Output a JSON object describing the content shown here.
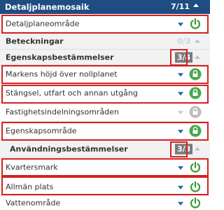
{
  "header": {
    "title": "Detaljplanemosaik",
    "count": "7/11"
  },
  "rows": {
    "detaljplaneomrade": {
      "label": "Detaljplaneområde"
    },
    "beteckningar": {
      "label": "Beteckningar",
      "count": "0/3"
    },
    "egenskapsbestammelser": {
      "label": "Egenskapsbestämmelser",
      "count": "3/4"
    },
    "markens_hojd": {
      "label": "Markens höjd över nollplanet"
    },
    "stangsel": {
      "label": "Stängsel, utfart och annan utgång"
    },
    "fastighetsindelning": {
      "label": "Fastighetsindelningsområden"
    },
    "egenskapsomrade": {
      "label": "Egenskapsområde"
    },
    "anvandningsbestammelser": {
      "label": "Användningsbestämmelser",
      "count": "3/3"
    },
    "kvartersmark": {
      "label": "Kvartersmark"
    },
    "allman_plats": {
      "label": "Allmän plats"
    },
    "vattenomrade": {
      "label": "Vattenområde"
    }
  },
  "colors": {
    "header_bg": "#1f4d82",
    "power_on": "#3a9a3a",
    "lock_on": "#49a84c",
    "lock_off": "#bdbdbd",
    "dropdown": "#1f5fa8",
    "highlight": "#d62020"
  },
  "icons": {
    "power": "power-icon",
    "lock": "lock-icon",
    "dropdown": "chevron-down-icon",
    "collapse": "chevron-up-icon"
  }
}
